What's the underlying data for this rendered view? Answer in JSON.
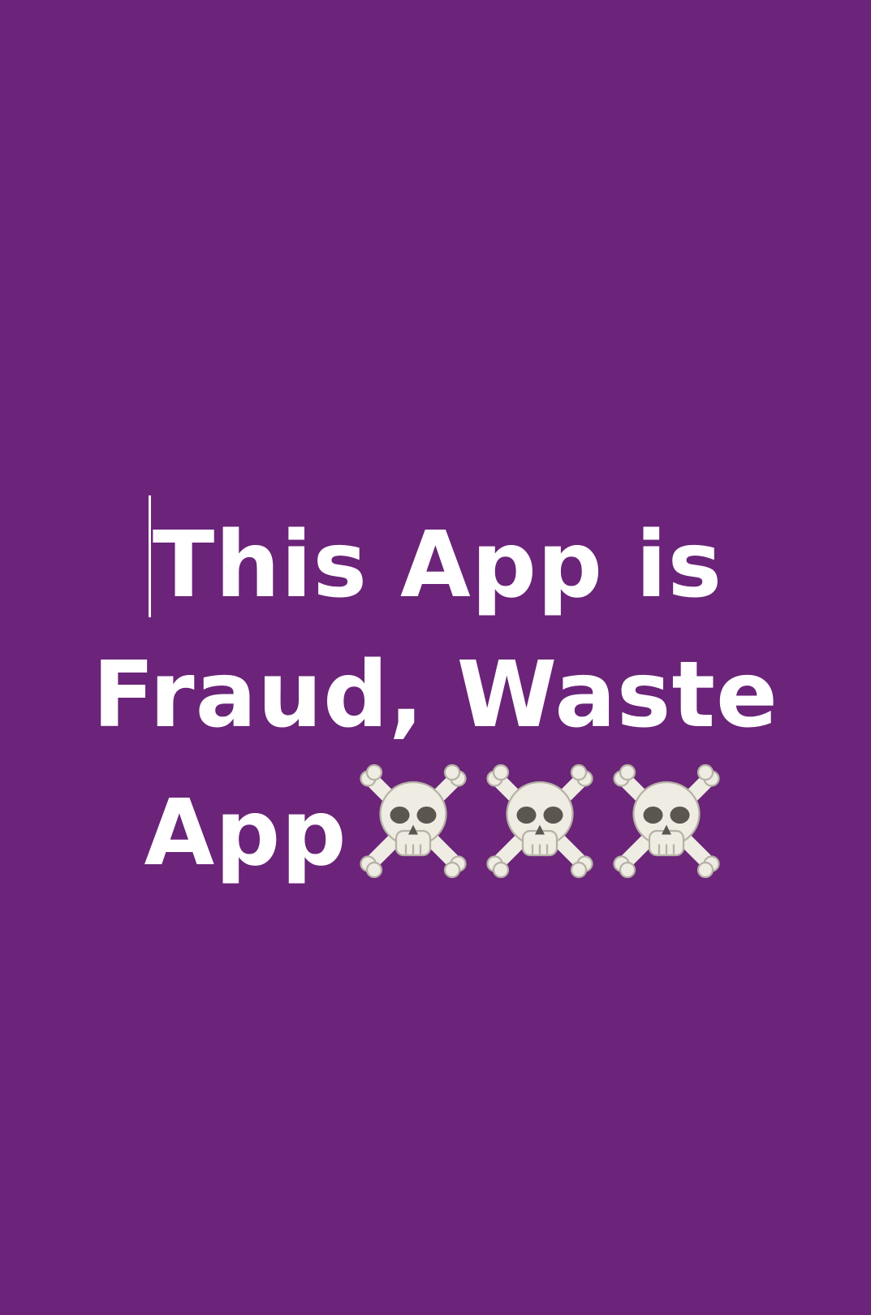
{
  "text": {
    "line1": "This App is",
    "line2": "Fraud, Waste",
    "line3": "App"
  },
  "icons": [
    "skull-and-crossbones-icon",
    "skull-and-crossbones-icon",
    "skull-and-crossbones-icon"
  ],
  "colors": {
    "background": "#6b2479",
    "text": "#ffffff",
    "bone": "#efece3",
    "shadow": "#b6b1a6",
    "socket": "#5b5650"
  }
}
